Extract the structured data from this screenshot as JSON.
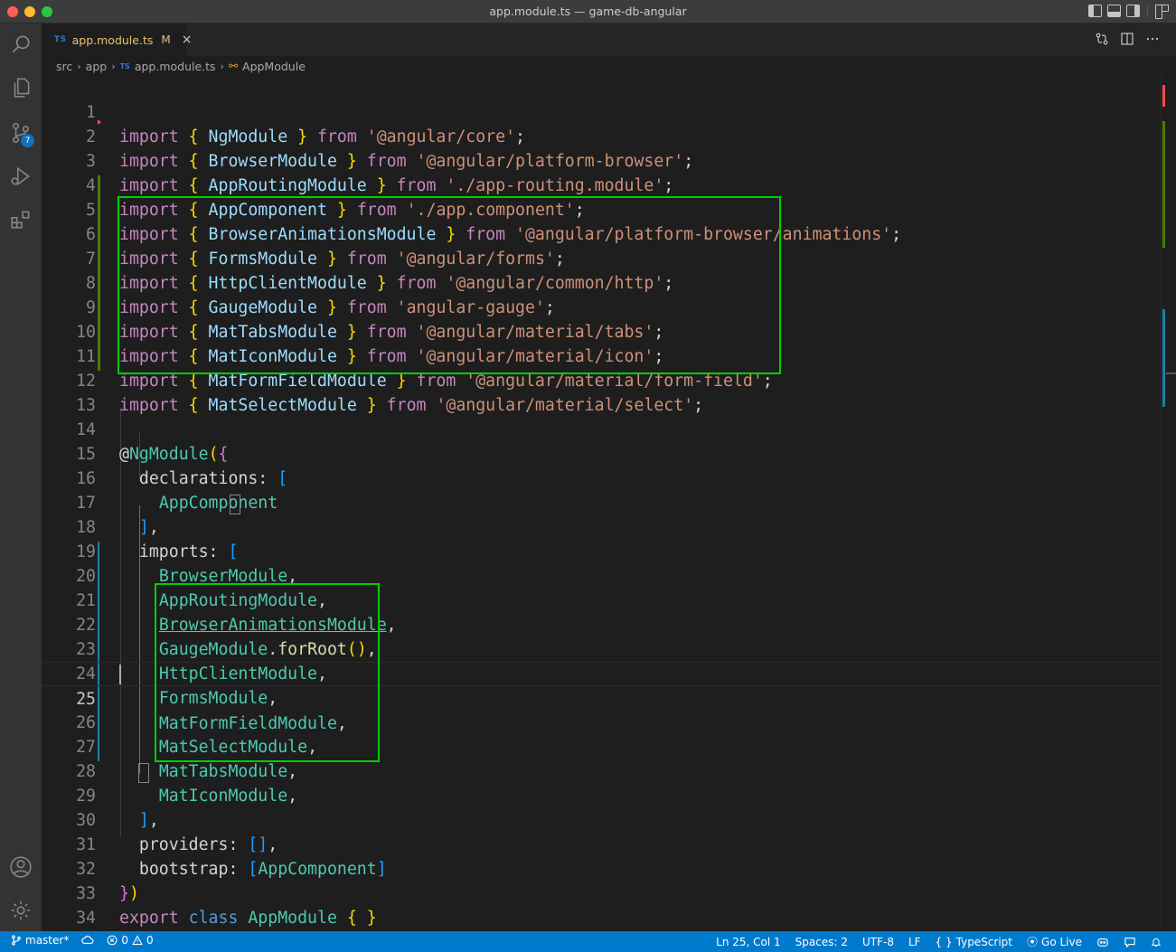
{
  "window": {
    "title": "app.module.ts — game-db-angular"
  },
  "activity_bar": {
    "items": [
      {
        "name": "explorer-search",
        "icon": "search-icon"
      },
      {
        "name": "explorer",
        "icon": "files-icon"
      },
      {
        "name": "source-control",
        "icon": "source-control-icon",
        "badge": "7"
      },
      {
        "name": "run-debug",
        "icon": "run-debug-icon"
      },
      {
        "name": "extensions",
        "icon": "extensions-icon"
      }
    ],
    "bottom": [
      {
        "name": "accounts",
        "icon": "account-icon"
      },
      {
        "name": "manage",
        "icon": "gear-icon"
      }
    ]
  },
  "tab": {
    "lang": "TS",
    "label": "app.module.ts",
    "modified": "M",
    "close": "×"
  },
  "breadcrumb": {
    "items": [
      "src",
      "app",
      "app.module.ts",
      "AppModule"
    ],
    "lang": "TS"
  },
  "editor": {
    "active_line": 25,
    "line_numbers": [
      "1",
      "2",
      "3",
      "4",
      "5",
      "6",
      "7",
      "8",
      "9",
      "10",
      "11",
      "12",
      "13",
      "14",
      "15",
      "16",
      "17",
      "18",
      "19",
      "20",
      "21",
      "22",
      "23",
      "24",
      "25",
      "26",
      "27",
      "28",
      "29",
      "30",
      "31",
      "32",
      "33",
      "34"
    ]
  },
  "code": {
    "kw_import": "import",
    "kw_from": "from",
    "ob": "{",
    "cb": "}",
    "semi": ";",
    "comma": ",",
    "l1_id": " NgModule ",
    "l1_str": "'@angular/core'",
    "l2_id": " BrowserModule ",
    "l2_str": "'@angular/platform-browser'",
    "l3_id": " AppRoutingModule ",
    "l3_str": "'./app-routing.module'",
    "l4_id": " AppComponent ",
    "l4_str": "'./app.component'",
    "l5_id": " BrowserAnimationsModule ",
    "l5_str": "'@angular/platform-browser/animations'",
    "l6_id": " FormsModule ",
    "l6_str": "'@angular/forms'",
    "l7_id": " HttpClientModule ",
    "l7_str": "'@angular/common/http'",
    "l8_id": " GaugeModule ",
    "l8_str": "'angular-gauge'",
    "l9_id": " MatTabsModule ",
    "l9_str": "'@angular/material/tabs'",
    "l10_id": " MatIconModule ",
    "l10_str": "'@angular/material/icon'",
    "l11_id": " MatFormFieldModule ",
    "l11_str": "'@angular/material/form-field'",
    "l12_id": " MatSelectModule ",
    "l12_str": "'@angular/material/select'",
    "l14_at": "@",
    "l14_dec": "NgModule",
    "l14_paren": "(",
    "l14_brace": "{",
    "l15_key": "declarations:",
    "l15_br": "[",
    "l16_val": "AppComponent",
    "l17_br": "]",
    "l18_key": "imports:",
    "l18_br": "[",
    "l19": "BrowserModule",
    "l20": "AppRoutingModule",
    "l21": "BrowserAnimationsModule",
    "l22_a": "GaugeModule",
    "l22_dot": ".",
    "l22_fn": "forRoot",
    "l22_p": "()",
    "l23": "HttpClientModule",
    "l24": "FormsModule",
    "l25": "MatFormFieldModule",
    "l26": "MatSelectModule",
    "l27": "MatTabsModule",
    "l28": "MatIconModule",
    "l29_br": "]",
    "l30_key": "providers:",
    "l30_br": "[]",
    "l31_key": "bootstrap:",
    "l31_ob": "[",
    "l31_val": "AppComponent",
    "l31_cb": "]",
    "l32_b": "}",
    "l32_p": ")",
    "l33_export": "export",
    "l33_class": "class",
    "l33_name": "AppModule",
    "l33_ob": "{",
    "l33_cb": "}"
  },
  "statusbar": {
    "branch": "master*",
    "sync": "",
    "errors": "0",
    "warnings": "0",
    "position": "Ln 25, Col 1",
    "spaces": "Spaces: 2",
    "encoding": "UTF-8",
    "eol": "LF",
    "language": "TypeScript",
    "go_live": "Go Live"
  },
  "colors": {
    "highlight_box": "#00d000",
    "statusbar": "#007acc"
  }
}
